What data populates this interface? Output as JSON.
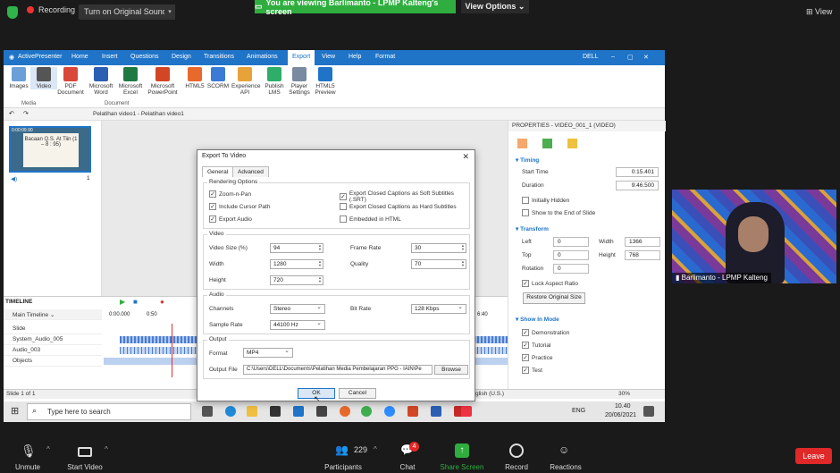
{
  "zoom_top": {
    "recording": "Recording",
    "sound": "Turn on Original Sound",
    "viewing": "You are viewing Barlimanto - LPMP Kalteng's screen",
    "view_options": "View Options",
    "view": "View"
  },
  "app": {
    "name": "ActivePresenter",
    "menu": [
      "Home",
      "Insert",
      "Questions",
      "Design",
      "Transitions",
      "Animations",
      "Export",
      "View",
      "Help",
      "Format"
    ],
    "user": "DELL",
    "ribbon": [
      {
        "label": "Images",
        "color": "#6a9fd8"
      },
      {
        "label": "Video",
        "color": "#555555"
      },
      {
        "label": "PDF Document",
        "color": "#d9473a"
      },
      {
        "label": "Microsoft Word",
        "color": "#2b5fb4"
      },
      {
        "label": "Microsoft Excel",
        "color": "#1f7a42"
      },
      {
        "label": "Microsoft PowerPoint",
        "color": "#d24625"
      },
      {
        "label": "HTML5",
        "color": "#e8692c"
      },
      {
        "label": "SCORM",
        "color": "#3a7bd5"
      },
      {
        "label": "Experience API",
        "color": "#e8a23a"
      },
      {
        "label": "Publish LMS",
        "color": "#2fae6a"
      },
      {
        "label": "Player Settings",
        "color": "#7a8aa0"
      },
      {
        "label": "HTML5 Preview",
        "color": "#1f74c8"
      }
    ],
    "groups": [
      "Media",
      "Document"
    ],
    "tab_label": "Pelatihan video1 - Pelatihan video1",
    "thumb_title": "Bacaan Q.S. At Tiin (1 – 8 : 95)",
    "thumb_time": "0:00:09.90",
    "slide_num": "1",
    "status_left": "Slide 1 of 1",
    "status_lang": "English (U.S.)",
    "status_zoom": "30%"
  },
  "props": {
    "header": "PROPERTIES - VIDEO_001_1 (VIDEO)",
    "timing_title": "Timing",
    "start_time_label": "Start Time",
    "start_time": "0:15.401",
    "duration_label": "Duration",
    "duration": "9:46.500",
    "initially_hidden": "Initially Hidden",
    "show_to_end": "Show to the End of Slide",
    "transform_title": "Transform",
    "left_label": "Left",
    "left": "0",
    "width_label": "Width",
    "width": "1366",
    "top_label": "Top",
    "top": "0",
    "height_label": "Height",
    "height": "768",
    "rotation_label": "Rotation",
    "rotation": "0",
    "lock_aspect": "Lock Aspect Ratio",
    "restore": "Restore Original Size",
    "show_in_mode": "Show In Mode",
    "modes": [
      "Demonstration",
      "Tutorial",
      "Practice",
      "Test"
    ]
  },
  "timeline": {
    "title": "TIMELINE",
    "main": "Main Timeline",
    "rows": [
      "Slide",
      "System_Audio_005",
      "Audio_003",
      "Objects"
    ],
    "ticks": [
      "0:00.000",
      "0:50"
    ],
    "tick_right": "6:40"
  },
  "dialog": {
    "title": "Export To Video",
    "tabs": [
      "General",
      "Advanced"
    ],
    "rendering": "Rendering Options",
    "zoom_pan": "Zoom-n-Pan",
    "include_cursor": "Include Cursor Path",
    "export_audio": "Export Audio",
    "cc_soft": "Export Closed Captions as Soft Subtitles (.SRT)",
    "cc_hard": "Export Closed Captions as Hard Subtitles",
    "embedded": "Embedded in HTML",
    "video": "Video",
    "video_size_label": "Video Size (%)",
    "video_size": "94",
    "frame_rate_label": "Frame Rate",
    "frame_rate": "30",
    "width_label": "Width",
    "width": "1280",
    "quality_label": "Quality",
    "quality": "70",
    "height_label": "Height",
    "height": "720",
    "audio": "Audio",
    "channels_label": "Channels",
    "channels": "Stereo",
    "bit_rate_label": "Bit Rate",
    "bit_rate": "128 Kbps",
    "sample_rate_label": "Sample Rate",
    "sample_rate": "44100 Hz",
    "output": "Output",
    "format_label": "Format",
    "format": "MP4",
    "output_file_label": "Output File",
    "output_file": "C:\\Users\\DELL\\Documents\\Pelatihan Media Pembelajaran PPG - IAIN\\Pe",
    "browse": "Browse",
    "ok": "OK",
    "cancel": "Cancel"
  },
  "taskbar": {
    "search": "Type here to search",
    "time": "10.40",
    "date": "20/06/2021",
    "lang": "ENG"
  },
  "cam": {
    "name": "Barlimanto - LPMP Kalteng"
  },
  "zoom_bottom": {
    "unmute": "Unmute",
    "start_video": "Start Video",
    "participants": "Participants",
    "participant_count": "229",
    "chat": "Chat",
    "chat_badge": "4",
    "share": "Share Screen",
    "record": "Record",
    "reactions": "Reactions",
    "leave": "Leave"
  }
}
